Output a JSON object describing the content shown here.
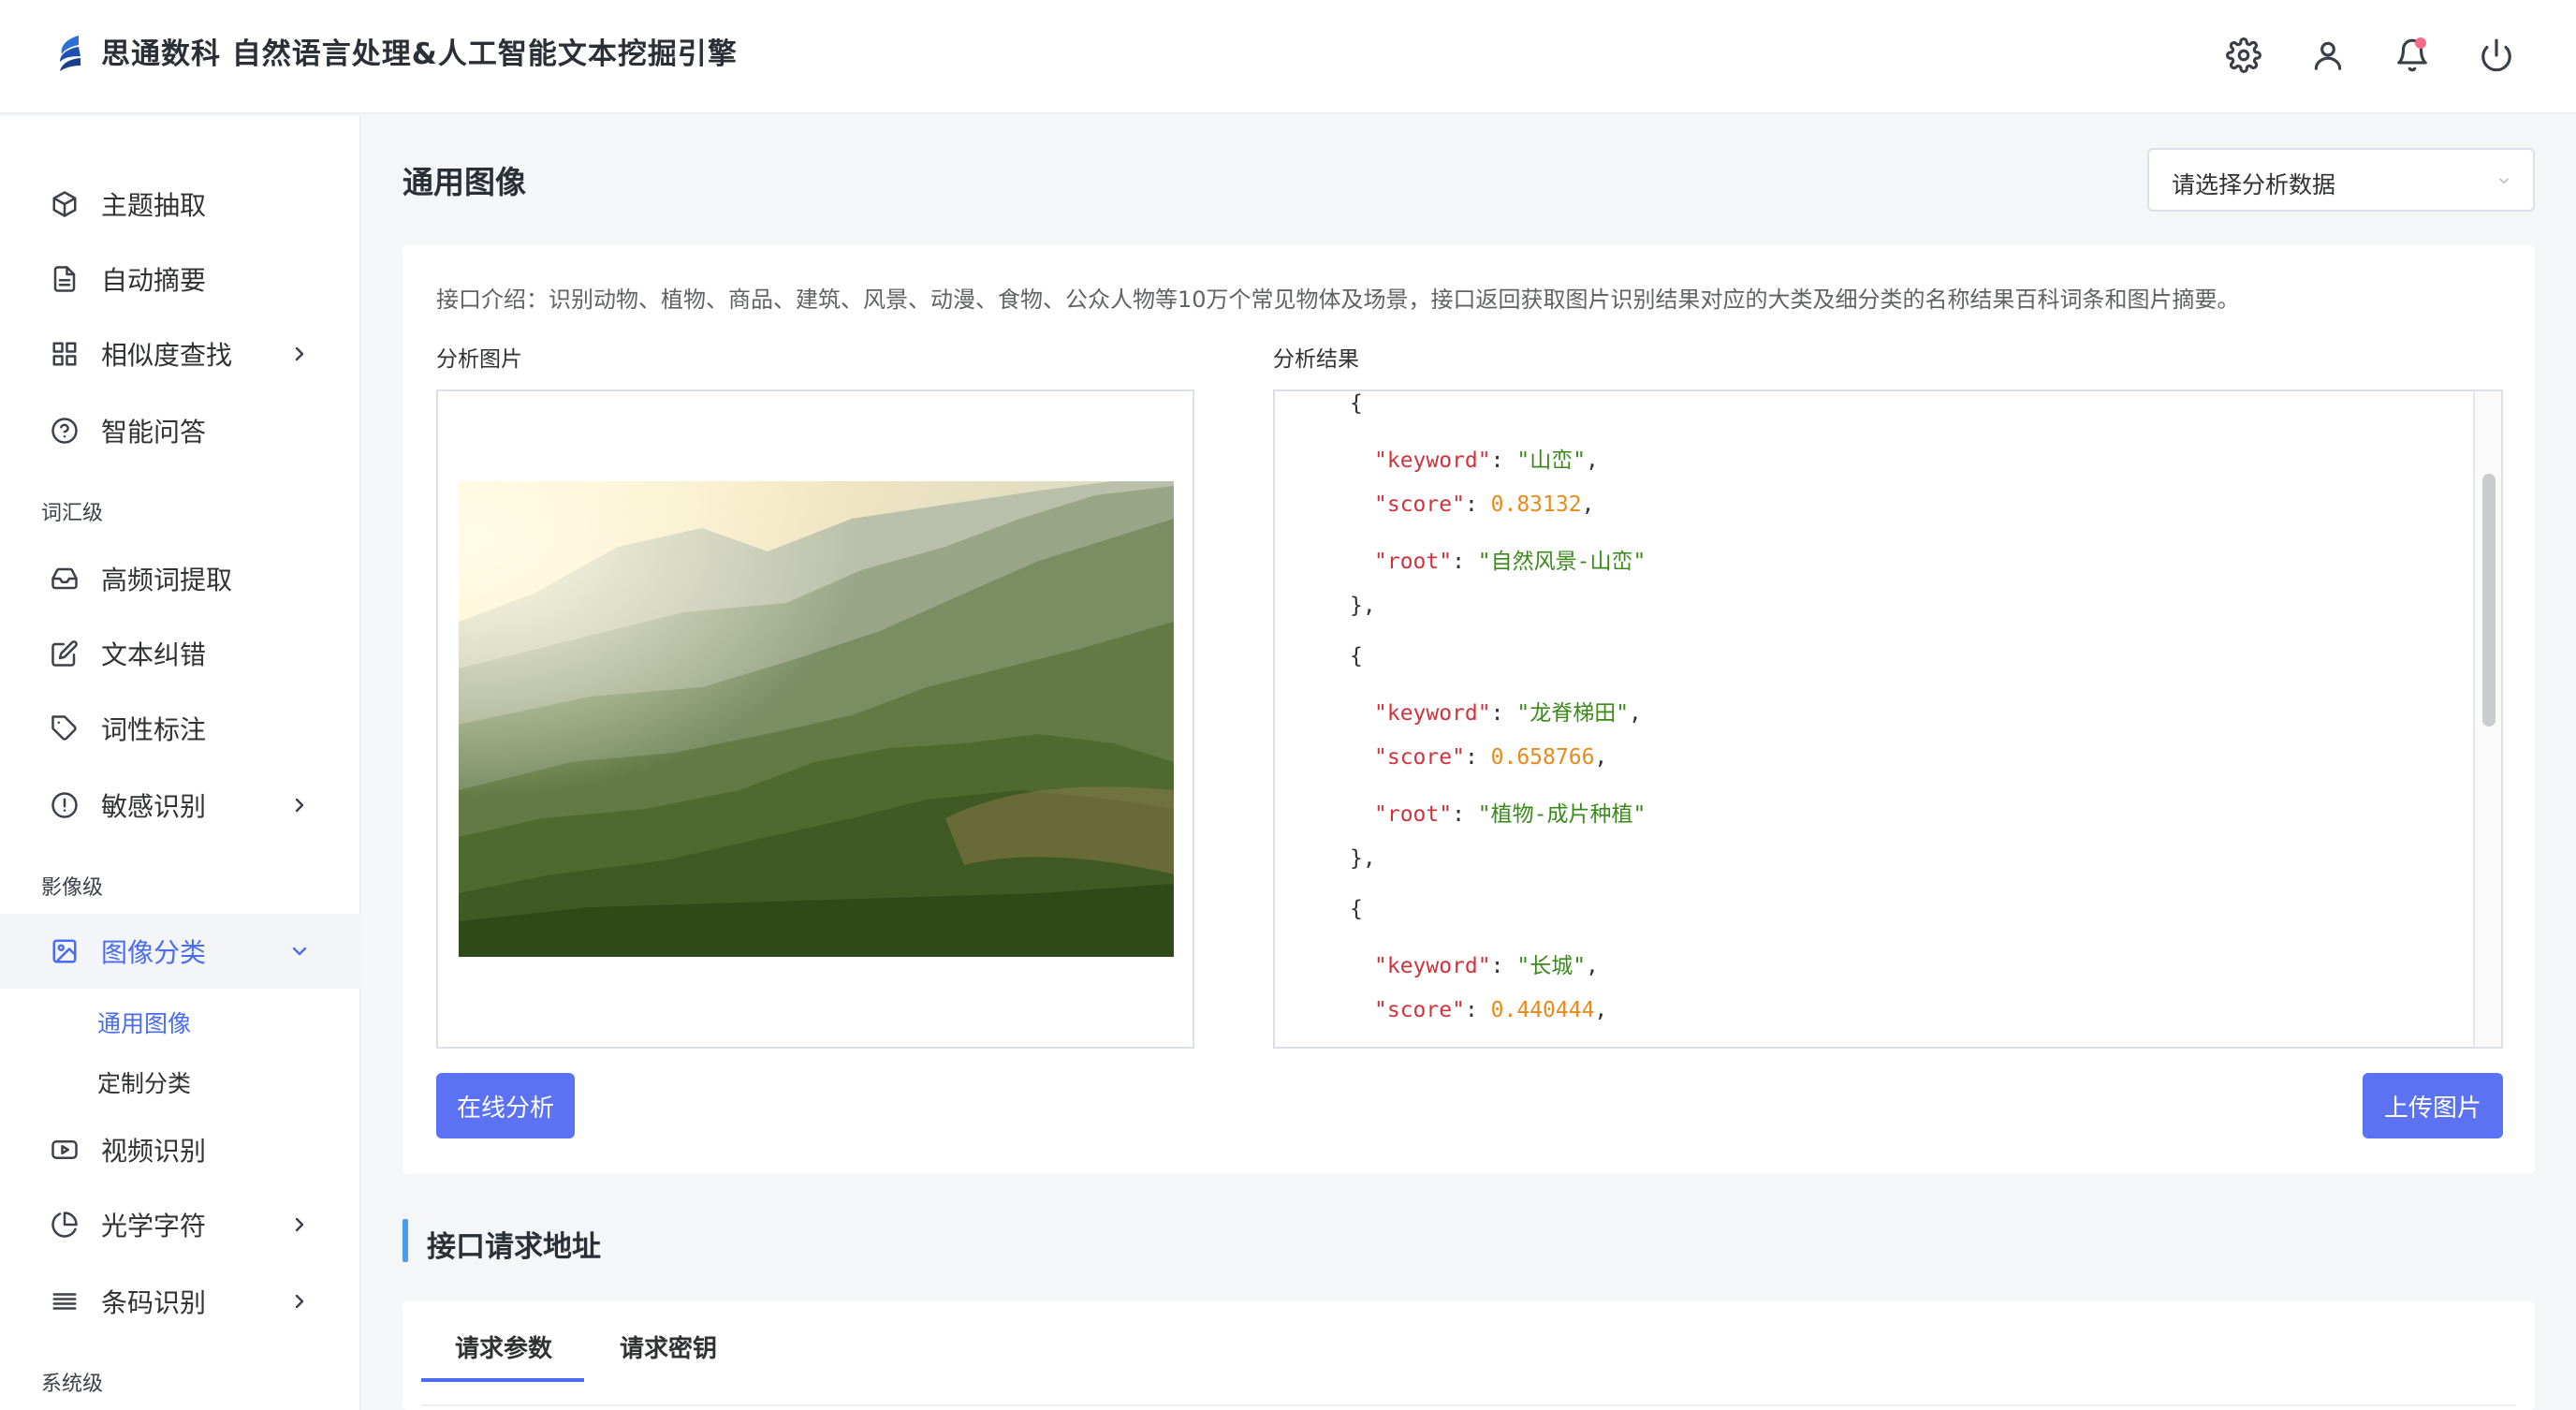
{
  "header": {
    "title": "思通数科 自然语言处理&人工智能文本挖掘引擎",
    "icons": [
      "gear-icon",
      "user-icon",
      "bell-icon",
      "power-icon"
    ]
  },
  "sidebar": {
    "items_top": [
      {
        "label": "主题抽取",
        "icon": "cube-icon"
      },
      {
        "label": "自动摘要",
        "icon": "document-icon"
      },
      {
        "label": "相似度查找",
        "icon": "grid-icon",
        "has_arrow": true
      },
      {
        "label": "智能问答",
        "icon": "question-icon"
      }
    ],
    "section_vocab": "词汇级",
    "items_vocab": [
      {
        "label": "高频词提取",
        "icon": "inbox-icon"
      },
      {
        "label": "文本纠错",
        "icon": "edit-icon"
      },
      {
        "label": "词性标注",
        "icon": "tag-icon"
      },
      {
        "label": "敏感识别",
        "icon": "alert-icon",
        "has_arrow": true
      }
    ],
    "section_image": "影像级",
    "image_group": {
      "label": "图像分类",
      "icon": "image-icon",
      "expanded": true
    },
    "image_sub": [
      "通用图像",
      "定制分类"
    ],
    "items_image": [
      {
        "label": "视频识别",
        "icon": "video-icon"
      },
      {
        "label": "光学字符",
        "icon": "pie-icon",
        "has_arrow": true
      },
      {
        "label": "条码识别",
        "icon": "barcode-icon",
        "has_arrow": true
      }
    ],
    "section_system": "系统级"
  },
  "main": {
    "page_title": "通用图像",
    "select_placeholder": "请选择分析数据",
    "intro": "接口介绍：识别动物、植物、商品、建筑、风景、动漫、食物、公众人物等10万个常见物体及场景，接口返回获取图片识别结果对应的大类及细分类的名称结果百科词条和图片摘要。",
    "image_label": "分析图片",
    "result_label": "分析结果",
    "result_items": [
      {
        "keyword": "山峦",
        "score": "0.83132",
        "root": "自然风景-山峦"
      },
      {
        "keyword": "龙脊梯田",
        "score": "0.658766",
        "root": "植物-成片种植"
      },
      {
        "keyword": "长城",
        "score": "0.440444"
      }
    ],
    "analyze_button": "在线分析",
    "upload_button": "上传图片",
    "api_section_title": "接口请求地址",
    "tabs": [
      "请求参数",
      "请求密钥"
    ]
  },
  "colors": {
    "accent": "#4a6cf0",
    "button": "#5b73f2",
    "json_key": "#d0333b",
    "json_string": "#3a8a1a",
    "json_number": "#e88a1b"
  }
}
